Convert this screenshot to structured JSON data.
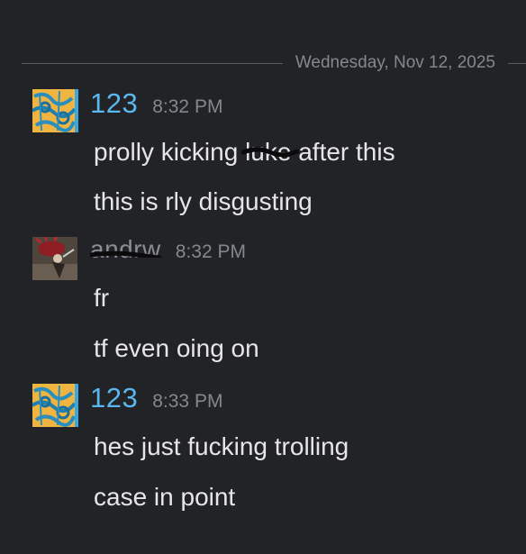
{
  "divider": {
    "date": "Wednesday, Nov 12, 2025"
  },
  "messages": [
    {
      "username": "123",
      "time": "8:32 PM",
      "avatar_icon": "blue-gold-pattern-avatar",
      "lines": [
        {
          "before": "prolly kicking ",
          "struck": "luke",
          "after": " after this"
        },
        {
          "text": "this is  rly disgusting"
        }
      ]
    },
    {
      "username": "andrw",
      "time": "8:32 PM",
      "avatar_icon": "dark-red-figure-avatar",
      "lines": [
        {
          "text": "fr"
        },
        {
          "text": "tf even oing on"
        }
      ]
    },
    {
      "username": "123",
      "time": "8:33 PM",
      "avatar_icon": "blue-gold-pattern-avatar",
      "lines": [
        {
          "text": "hes just fucking trolling"
        },
        {
          "text": "case in point"
        }
      ]
    }
  ],
  "colors": {
    "background": "#222327",
    "username_blue": "#5ab8f0",
    "timestamp": "#86878c",
    "text": "#e6e6e8"
  }
}
